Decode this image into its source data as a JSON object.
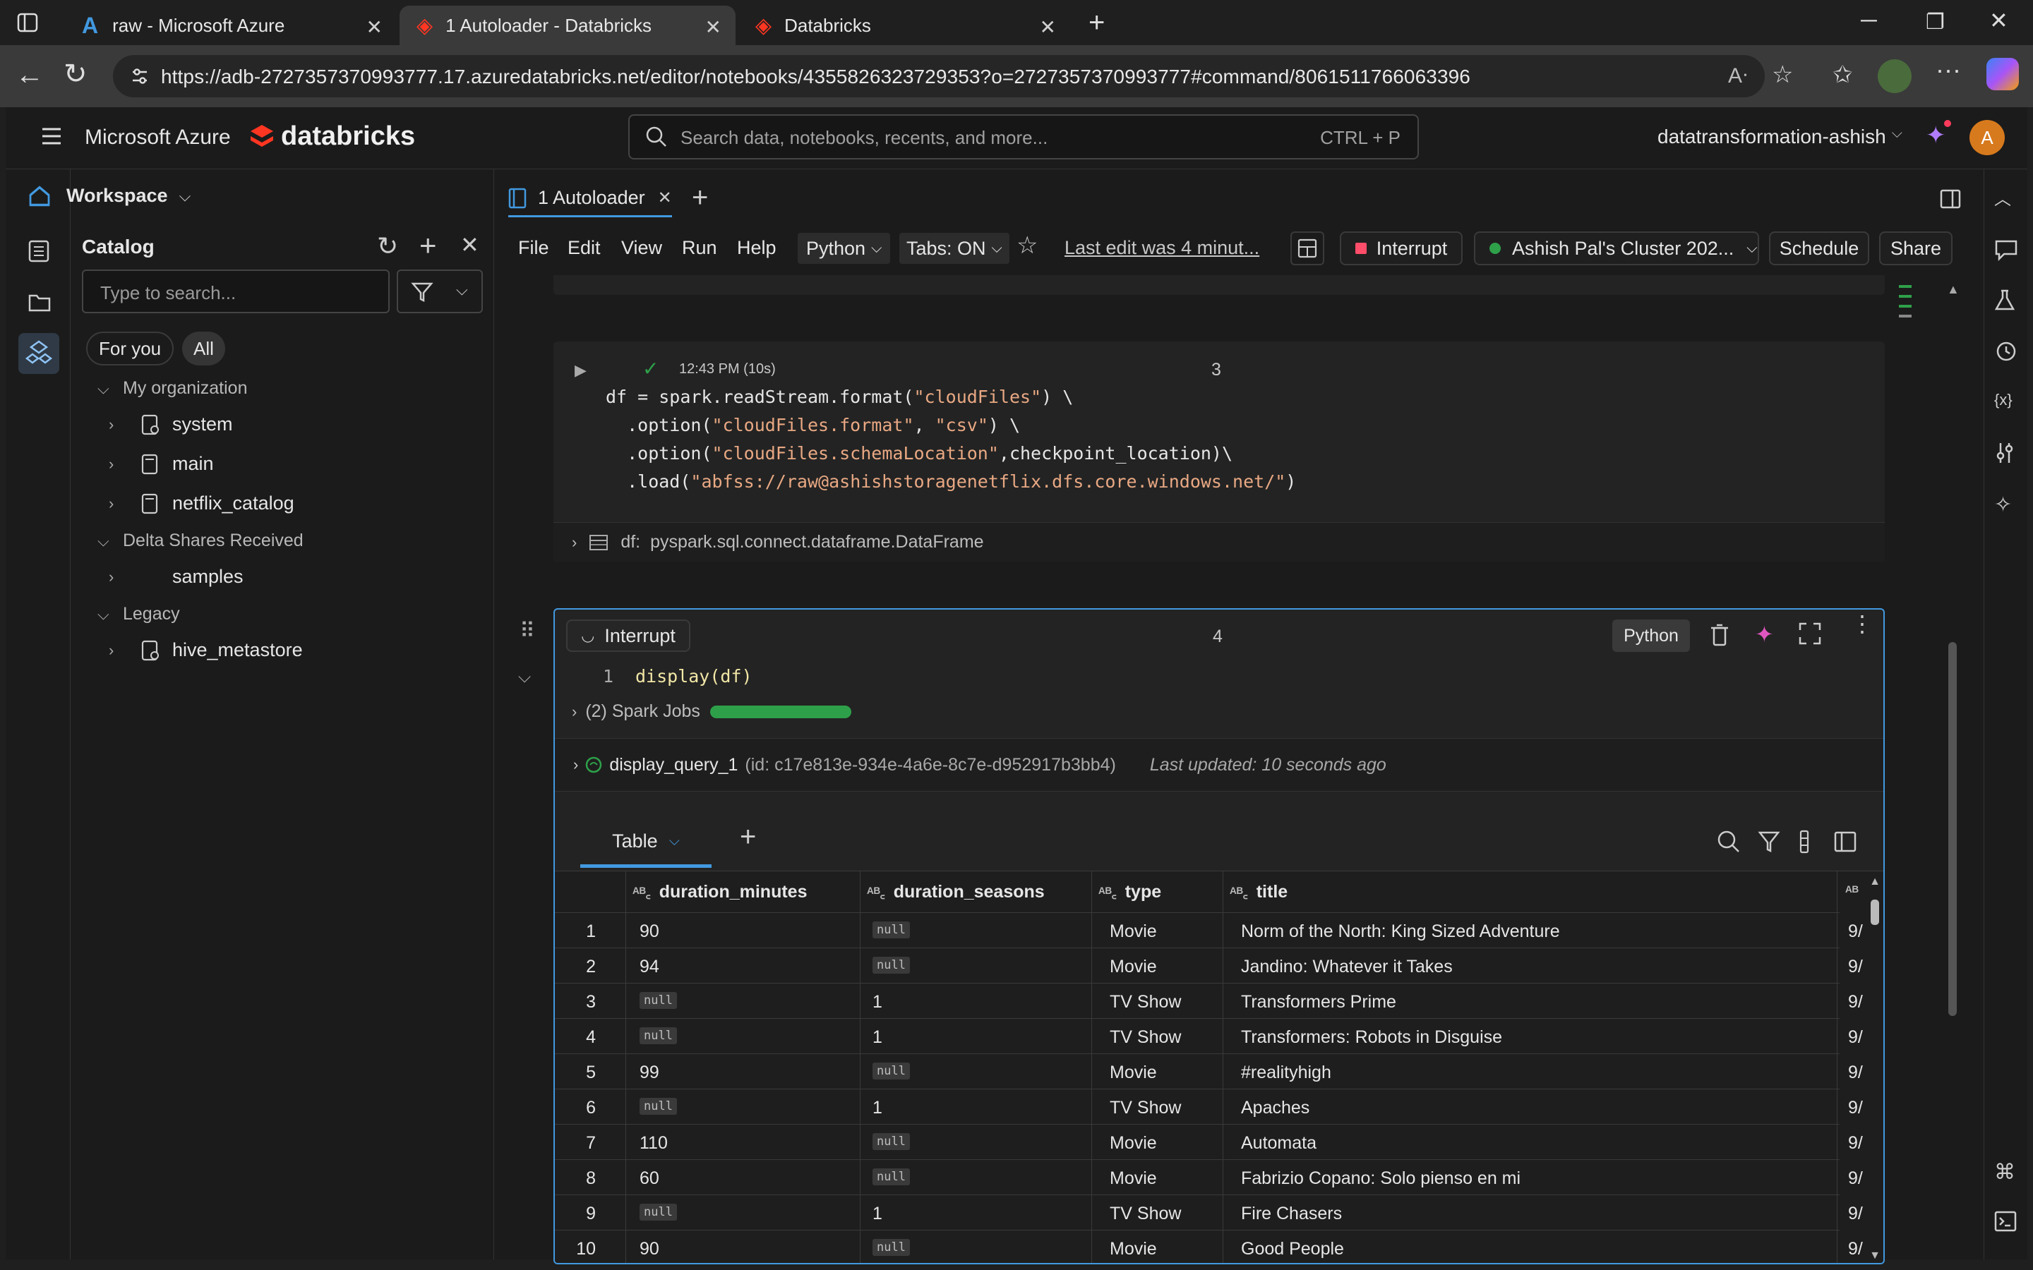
{
  "browser": {
    "tabs": [
      {
        "title": "raw - Microsoft Azure"
      },
      {
        "title": "1 Autoloader - Databricks"
      },
      {
        "title": "Databricks"
      }
    ],
    "url": "https://adb-2727357370993777.17.azuredatabricks.net/editor/notebooks/4355826323729353?o=2727357370993777#command/8061511766063396"
  },
  "header": {
    "brand_azure": "Microsoft Azure",
    "brand_databricks": "databricks",
    "search_placeholder": "Search data, notebooks, recents, and more...",
    "search_shortcut": "CTRL + P",
    "workspace_name": "datatransformation-ashish",
    "avatar_letter": "A"
  },
  "sidebar": {
    "workspace_label": "Workspace",
    "catalog_title": "Catalog",
    "search_placeholder": "Type to search...",
    "filter_for_you": "For you",
    "filter_all": "All",
    "sections": [
      {
        "label": "My organization",
        "items": [
          "system",
          "main",
          "netflix_catalog"
        ]
      },
      {
        "label": "Delta Shares Received",
        "items": [
          "samples"
        ]
      },
      {
        "label": "Legacy",
        "items": [
          "hive_metastore"
        ]
      }
    ]
  },
  "notebook": {
    "tab_title": "1 Autoloader",
    "menu": [
      "File",
      "Edit",
      "View",
      "Run",
      "Help"
    ],
    "language": "Python",
    "tabs_toggle": "Tabs: ON",
    "last_edit": "Last edit was 4 minut...",
    "interrupt": "Interrupt",
    "cluster": "Ashish Pal's Cluster 202...",
    "schedule": "Schedule",
    "share": "Share"
  },
  "cell3": {
    "status": "12:43 PM (10s)",
    "number": "3",
    "code": {
      "l1a": "df = spark.readStream.format(",
      "l1s": "\"cloudFiles\"",
      "l1b": ") \\",
      "l2a": "  .option(",
      "l2s1": "\"cloudFiles.format\"",
      "l2c": ", ",
      "l2s2": "\"csv\"",
      "l2b": ") \\",
      "l3a": "  .option(",
      "l3s": "\"cloudFiles.schemaLocation\"",
      "l3b": ",checkpoint_location)\\",
      "l4a": "  .load(",
      "l4s": "\"abfss://raw@ashishstoragenetflix.dfs.core.windows.net/\"",
      "l4b": ")"
    },
    "df_label": "df:",
    "df_type": "pyspark.sql.connect.dataframe.DataFrame"
  },
  "cell4": {
    "interrupt": "Interrupt",
    "number": "4",
    "language": "Python",
    "line_no": "1",
    "code": "display(df)",
    "spark_jobs": "(2) Spark Jobs",
    "spark_progress": 1.0,
    "query_name": "display_query_1",
    "query_id": "(id: c17e813e-934e-4a6e-8c7e-d952917b3bb4)",
    "last_updated": "Last updated: 10 seconds ago",
    "result_tab": "Table"
  },
  "table": {
    "columns": [
      "duration_minutes",
      "duration_seasons",
      "type",
      "title"
    ],
    "rows": [
      {
        "n": "1",
        "duration_minutes": "90",
        "duration_seasons": "null",
        "type": "Movie",
        "title": "Norm of the North: King Sized Adventure",
        "extra": "9/"
      },
      {
        "n": "2",
        "duration_minutes": "94",
        "duration_seasons": "null",
        "type": "Movie",
        "title": "Jandino: Whatever it Takes",
        "extra": "9/"
      },
      {
        "n": "3",
        "duration_minutes": "null",
        "duration_seasons": "1",
        "type": "TV Show",
        "title": "Transformers Prime",
        "extra": "9/"
      },
      {
        "n": "4",
        "duration_minutes": "null",
        "duration_seasons": "1",
        "type": "TV Show",
        "title": "Transformers: Robots in Disguise",
        "extra": "9/"
      },
      {
        "n": "5",
        "duration_minutes": "99",
        "duration_seasons": "null",
        "type": "Movie",
        "title": "#realityhigh",
        "extra": "9/"
      },
      {
        "n": "6",
        "duration_minutes": "null",
        "duration_seasons": "1",
        "type": "TV Show",
        "title": "Apaches",
        "extra": "9/"
      },
      {
        "n": "7",
        "duration_minutes": "110",
        "duration_seasons": "null",
        "type": "Movie",
        "title": "Automata",
        "extra": "9/"
      },
      {
        "n": "8",
        "duration_minutes": "60",
        "duration_seasons": "null",
        "type": "Movie",
        "title": "Fabrizio Copano: Solo pienso en mi",
        "extra": "9/"
      },
      {
        "n": "9",
        "duration_minutes": "null",
        "duration_seasons": "1",
        "type": "TV Show",
        "title": "Fire Chasers",
        "extra": "9/"
      },
      {
        "n": "10",
        "duration_minutes": "90",
        "duration_seasons": "null",
        "type": "Movie",
        "title": "Good People",
        "extra": "9/"
      }
    ]
  },
  "colors": {
    "accent_blue": "#4299e0",
    "databricks_red": "#ff3621",
    "success_green": "#2ea04a",
    "link_blue": "#8ab4f8"
  }
}
